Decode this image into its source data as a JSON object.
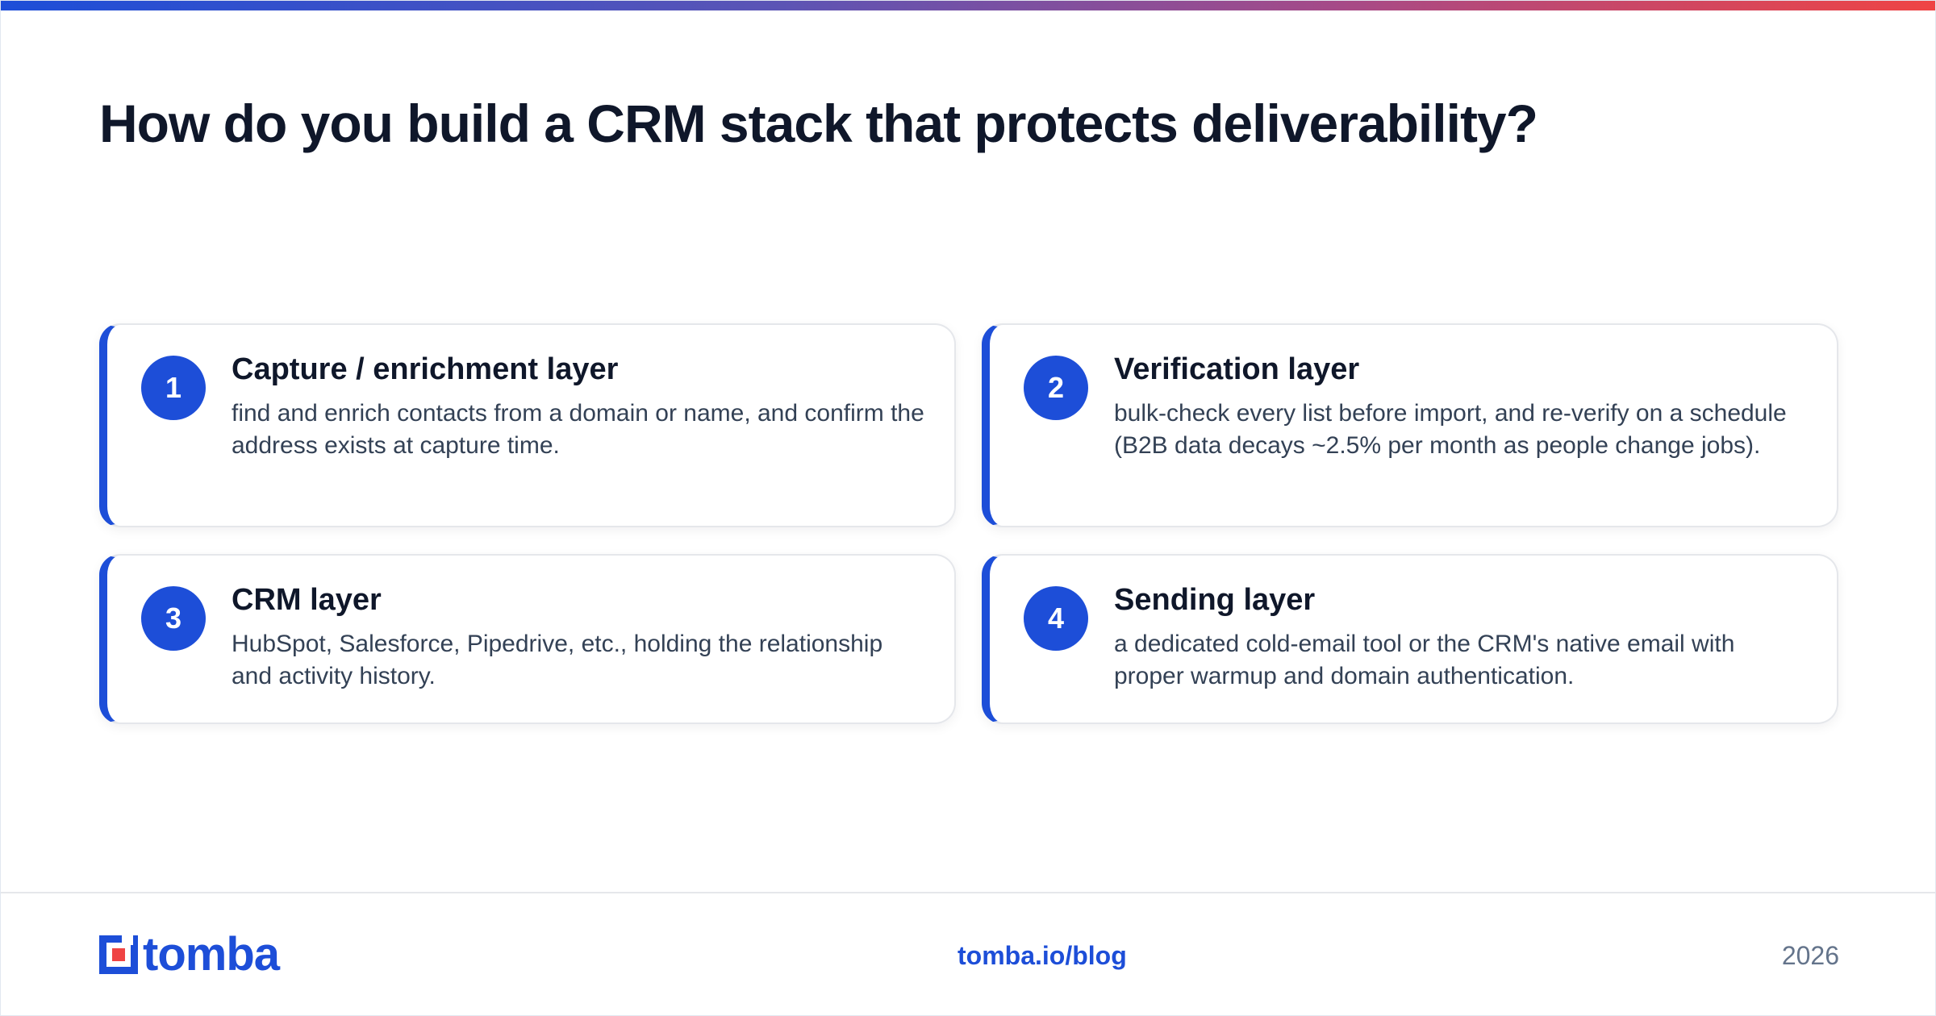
{
  "header": {
    "title": "How do you build a CRM stack that protects deliverability?"
  },
  "cards": [
    {
      "number": "1",
      "title": "Capture / enrichment layer",
      "description": "find and enrich contacts from a domain or name, and confirm the address exists at capture time."
    },
    {
      "number": "2",
      "title": "Verification layer",
      "description": "bulk-check every list before import, and re-verify on a schedule (B2B data decays ~2.5% per month as people change jobs)."
    },
    {
      "number": "3",
      "title": "CRM layer",
      "description": "HubSpot, Salesforce, Pipedrive, etc., holding the relationship and activity history."
    },
    {
      "number": "4",
      "title": "Sending layer",
      "description": "a dedicated cold-email tool or the CRM's native email with proper warmup and domain authentication."
    }
  ],
  "footer": {
    "logo_text": "tomba",
    "link": "tomba.io/blog",
    "year": "2026"
  },
  "colors": {
    "accent": "#1d4ed8",
    "logo_dot": "#ef4444",
    "gradient_end": "#ef4444",
    "heading": "#0f172a",
    "body_text": "#334155",
    "muted": "#64748b"
  },
  "icons": {
    "logo_mark": "tomba-logo-icon"
  }
}
